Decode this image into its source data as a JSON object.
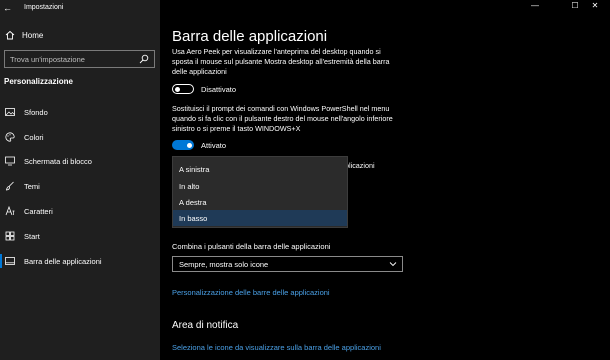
{
  "window": {
    "title": "Impostazioni",
    "controls": {
      "minimize": "—",
      "maximize": "☐",
      "close": "✕"
    }
  },
  "sidebar": {
    "home_label": "Home",
    "search_placeholder": "Trova un'impostazione",
    "section_title": "Personalizzazione",
    "items": [
      {
        "label": "Sfondo",
        "icon": "picture-icon"
      },
      {
        "label": "Colori",
        "icon": "palette-icon"
      },
      {
        "label": "Schermata di blocco",
        "icon": "monitor-icon"
      },
      {
        "label": "Temi",
        "icon": "brush-icon"
      },
      {
        "label": "Caratteri",
        "icon": "font-icon"
      },
      {
        "label": "Start",
        "icon": "start-icon"
      },
      {
        "label": "Barra delle applicazioni",
        "icon": "taskbar-icon"
      }
    ],
    "active_item": "Barra delle applicazioni"
  },
  "main": {
    "title": "Barra delle applicazioni",
    "aero_peek": {
      "description": "Usa Aero Peek per visualizzare l'anteprima del desktop quando si sposta il mouse sul pulsante Mostra desktop all'estremità della barra delle applicazioni",
      "state": "Disattivato"
    },
    "powershell": {
      "description": "Sostituisci il prompt dei comandi con Windows PowerShell nel menu quando si fa clic con il pulsante destro del mouse nell'angolo inferiore sinistro o si preme il tasto WINDOWS+X",
      "state": "Attivato"
    },
    "partial_text": "plicazioni",
    "position_dropdown": {
      "options": [
        "A sinistra",
        "In alto",
        "A destra",
        "In basso"
      ],
      "selected": "In basso"
    },
    "combine_label": "Combina i pulsanti della barra delle applicazioni",
    "combine_value": "Sempre, mostra solo icone",
    "customize_link": "Personalizzazione delle barre delle applicazioni",
    "notification_heading": "Area di notifica",
    "notification_link": "Seleziona le icone da visualizzare sulla barra delle applicazioni"
  },
  "colors": {
    "accent": "#0078d7",
    "link": "#4aa0e6",
    "sidebar_bg": "#1f1f1f",
    "main_bg": "#000000"
  }
}
